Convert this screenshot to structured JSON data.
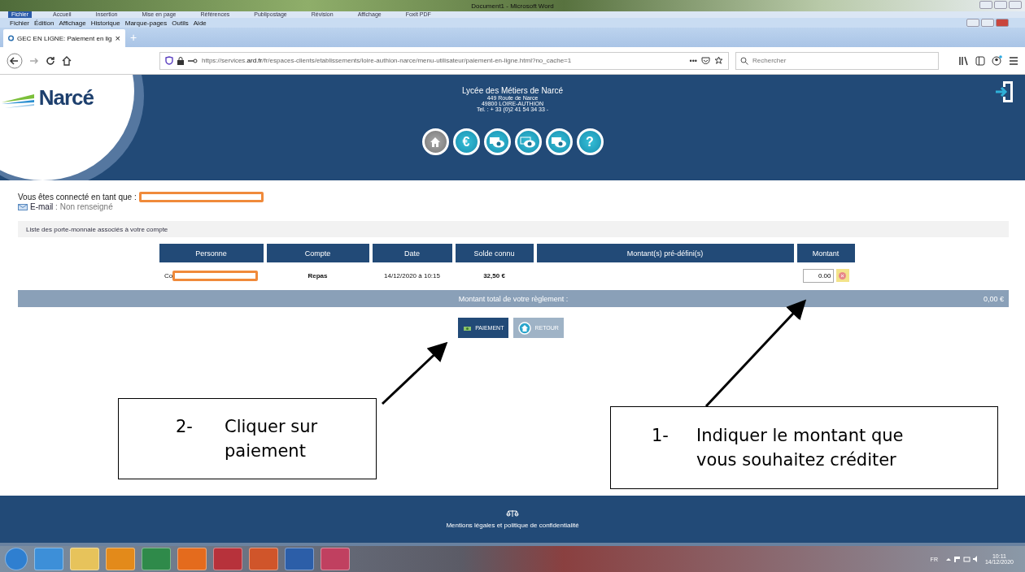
{
  "word_window": {
    "title": "Document1 - Microsoft Word",
    "ribbon_tabs": [
      {
        "label": "Fichier",
        "selected": true
      },
      {
        "label": "Accueil",
        "selected": false
      },
      {
        "label": "Insertion",
        "selected": false
      },
      {
        "label": "Mise en page",
        "selected": false
      },
      {
        "label": "Références",
        "selected": false
      },
      {
        "label": "Publipostage",
        "selected": false
      },
      {
        "label": "Révision",
        "selected": false
      },
      {
        "label": "Affichage",
        "selected": false
      },
      {
        "label": "Foxit PDF",
        "selected": false
      }
    ]
  },
  "browser": {
    "menu": [
      "Fichier",
      "Édition",
      "Affichage",
      "Historique",
      "Marque-pages",
      "Outils",
      "Aide"
    ],
    "tab": {
      "title": "GEC EN LIGNE: Paiement en lig",
      "close": "×",
      "new_tab": "+"
    },
    "url": {
      "prefix": "https://services.",
      "domain": "ard.fr",
      "rest": "/fr/espaces-clients/etablissements/loire-authion-narce/menu-utilisateur/paiement-en-ligne.html?no_cache=1"
    },
    "page_actions": "•••",
    "search": {
      "placeholder": "Rechercher"
    }
  },
  "site_header": {
    "logo": "Narcé",
    "school": "Lycée des Métiers de Narcé",
    "address": [
      "449 Route de Narce",
      "49800 LOIRE-AUTHION",
      "Tel. : + 33 (0)2 41 54 34 33 -"
    ],
    "nav_icons": [
      {
        "kind": "home",
        "selected": true
      },
      {
        "kind": "glyph",
        "label": "€",
        "selected": false
      },
      {
        "kind": "eye",
        "selected": false
      },
      {
        "kind": "card-eye",
        "selected": false
      },
      {
        "kind": "eye",
        "selected": false
      },
      {
        "kind": "glyph",
        "label": "?",
        "selected": false
      }
    ]
  },
  "user": {
    "connected_label": "Vous êtes connecté en tant que :",
    "email": "**E-mail** : Non renseigné"
  },
  "wallets": {
    "title": "Liste des porte-monnaie associés à votre compte",
    "columns": [
      "Personne",
      "Compte",
      "Date",
      "Solde connu",
      "Montant(s) pré-défini(s)",
      "Montant"
    ],
    "rows": [
      {
        "person": "Co",
        "account": "Repas",
        "date": "14/12/2020 à 10:15",
        "balance": "32,50 €",
        "amount": "0.00"
      }
    ],
    "total_label": "Montant total de votre règlement :",
    "total": "0,00 €"
  },
  "buttons": [
    {
      "label": "PAIEMENT",
      "kind": "primary"
    },
    {
      "label": "RETOUR",
      "kind": "secondary"
    }
  ],
  "footer": {
    "link": "Mentions légales et politique de confidentialité"
  },
  "annotations": [
    {
      "number": "2-",
      "lines": [
        "Cliquer sur",
        "paiement"
      ]
    },
    {
      "number": "1-",
      "lines": [
        "Indiquer le montant que",
        "vous souhaitez créditer"
      ]
    }
  ],
  "taskbar": {
    "language": "FR",
    "time": "10:11",
    "date": "14/12/2020"
  }
}
